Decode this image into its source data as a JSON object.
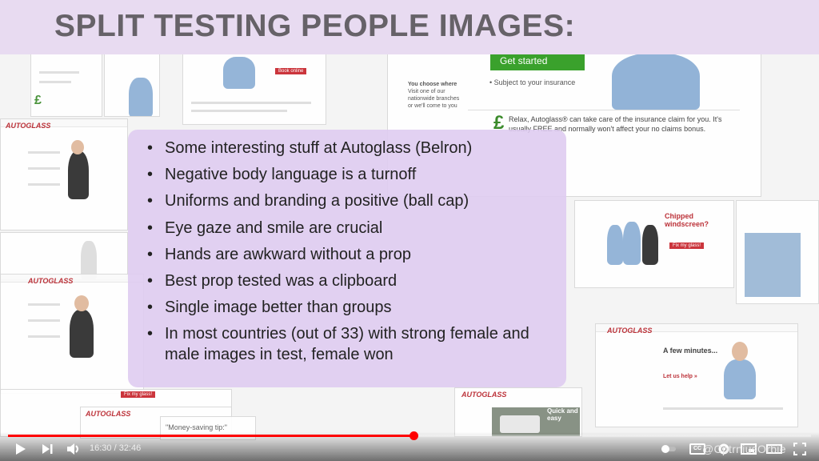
{
  "slide": {
    "title": "SPLIT TESTING PEOPLE IMAGES:",
    "bullets": [
      "Some interesting stuff at Autoglass (Belron)",
      "Negative body language is a turnoff",
      "Uniforms and branding a positive (ball cap)",
      "Eye gaze and smile are crucial",
      "Hands are awkward without a prop",
      "Best prop tested was a clipboard",
      "Single image better than groups",
      "In most countries (out of 33) with strong female and male images in test, female won"
    ]
  },
  "background_page": {
    "get_started": "Get started",
    "subject_to": "• Subject to your insurance",
    "relax_text": "Relax, Autoglass® can take care of the insurance claim for you. It's usually FREE and normally won't affect your no claims bonus.",
    "you_choose": "You choose where",
    "you_choose_sub": "Visit one of our nationwide branches or we'll come to you",
    "autoglass": "AUTOGLASS",
    "chipped": "Chipped windscreen?",
    "few_minutes": "A few minutes...",
    "money_saving": "\"Money-saving tip:\"",
    "quick_easy": "Quick and easy",
    "lets_help": "Let us help »",
    "book_online": "Book online"
  },
  "player": {
    "progress": 0.505,
    "time_current": "16:30",
    "time_total": "32:46",
    "time_display": "16:30 / 32:46",
    "cc_label": "CC",
    "watermark": "@CptrniusOrbie",
    "accent": "#ff0000"
  }
}
